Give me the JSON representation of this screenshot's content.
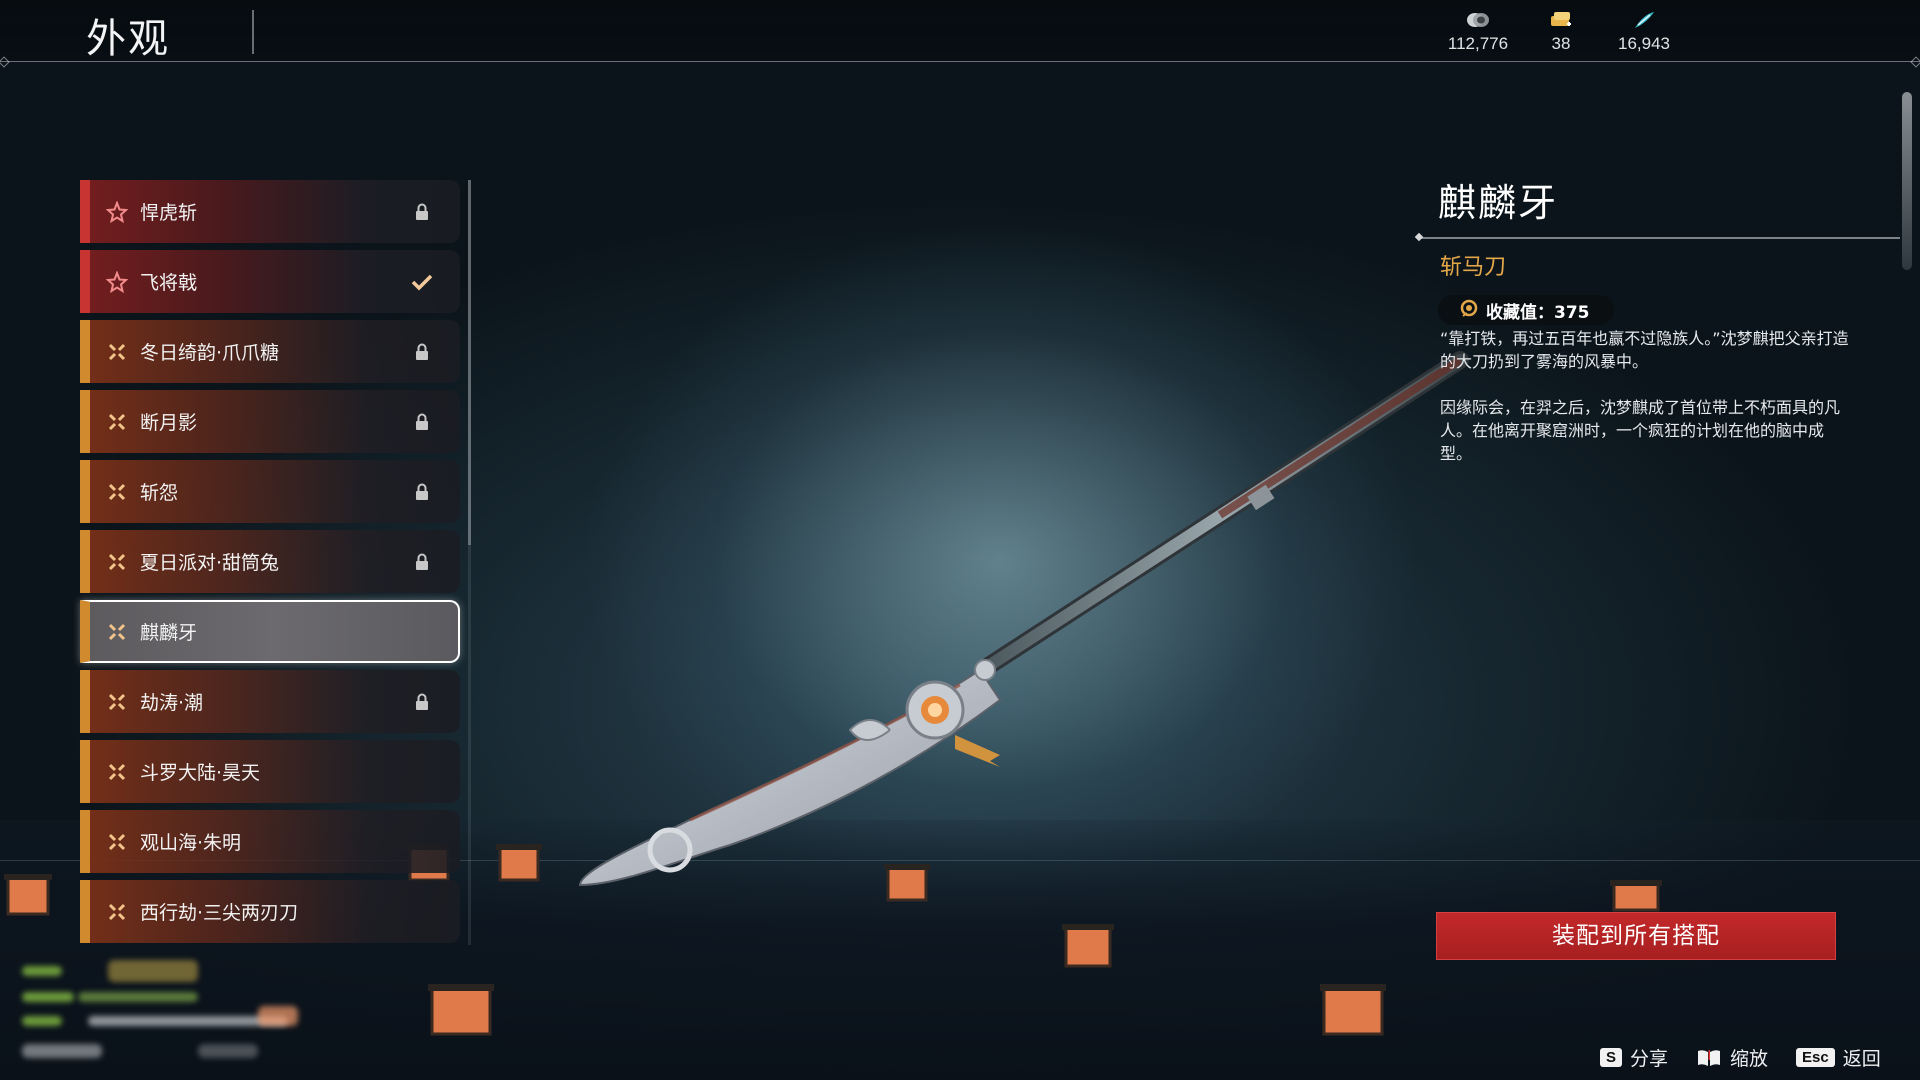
{
  "header": {
    "title": "外观",
    "currencies": [
      {
        "icon": "coin-icon",
        "value": "112,776"
      },
      {
        "icon": "ticket-icon",
        "value": "38"
      },
      {
        "icon": "feather-icon",
        "value": "16,943"
      }
    ]
  },
  "skin_list": {
    "items": [
      {
        "label": "悍虎斩",
        "rarity": "red",
        "status": "locked"
      },
      {
        "label": "飞将戟",
        "rarity": "red",
        "status": "equipped"
      },
      {
        "label": "冬日绮韵·爪爪糖",
        "rarity": "orange",
        "status": "locked"
      },
      {
        "label": "断月影",
        "rarity": "orange",
        "status": "locked"
      },
      {
        "label": "斩怨",
        "rarity": "orange",
        "status": "locked"
      },
      {
        "label": "夏日派对·甜筒兔",
        "rarity": "orange",
        "status": "locked"
      },
      {
        "label": "麒麟牙",
        "rarity": "orange",
        "status": "selected"
      },
      {
        "label": "劫涛·潮",
        "rarity": "orange",
        "status": "locked"
      },
      {
        "label": "斗罗大陆·昊天",
        "rarity": "orange",
        "status": "none"
      },
      {
        "label": "观山海·朱明",
        "rarity": "orange",
        "status": "none"
      },
      {
        "label": "西行劫·三尖两刃刀",
        "rarity": "orange",
        "status": "none"
      }
    ]
  },
  "detail": {
    "name": "麒麟牙",
    "type": "斩马刀",
    "collection_label": "收藏值：375",
    "description": [
      "“靠打铁，再过五百年也赢不过隐族人。”沈梦麒把父亲打造的大刀扔到了雾海的风暴中。",
      "因缘际会，在羿之后，沈梦麒成了首位带上不朽面具的凡人。在他离开聚窟洲时，一个疯狂的计划在他的脑中成型。"
    ]
  },
  "actions": {
    "equip_all": "装配到所有搭配"
  },
  "hints": [
    {
      "key": "S",
      "label": "分享"
    },
    {
      "key": "book-icon",
      "label": "缩放"
    },
    {
      "key": "Esc",
      "label": "返回"
    }
  ],
  "colors": {
    "accent_red": "#c73432",
    "accent_orange": "#d18b2e",
    "type_gold": "#e3a74a",
    "button_red": "#b82425"
  }
}
